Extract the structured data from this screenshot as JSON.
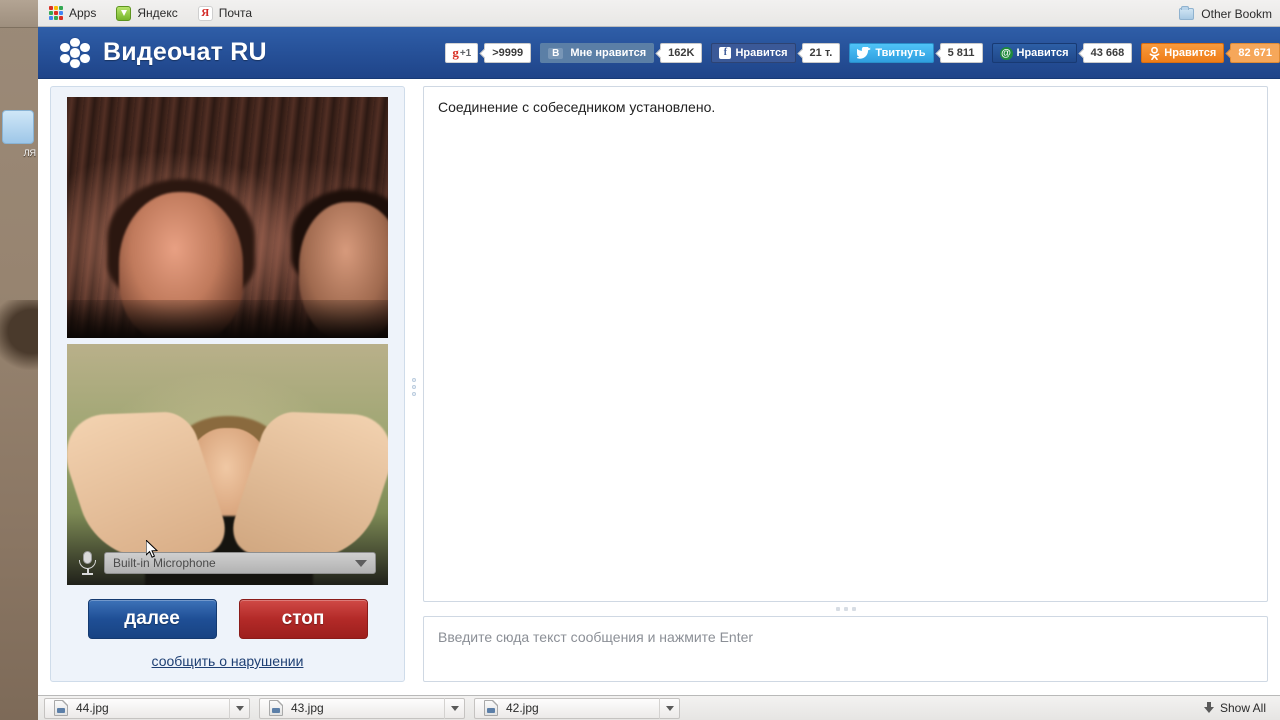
{
  "browser": {
    "bookmarks": [
      {
        "label": "Apps",
        "icon": "apps-grid-icon"
      },
      {
        "label": "Яндекс",
        "icon": "yandex-icon"
      },
      {
        "label": "Почта",
        "icon": "mail-icon"
      }
    ],
    "other_bookmarks": {
      "label": "Other Bookm",
      "icon": "folder-icon"
    }
  },
  "site": {
    "brand": "Видеочат RU",
    "brand_icon": "flower-logo-icon",
    "header_color": "#27529a",
    "social": [
      {
        "name": "google-plus",
        "label": "+1",
        "glyph": "g",
        "count": ">9999"
      },
      {
        "name": "vkontakte",
        "label": "Мне нравится",
        "glyph": "В",
        "count": "162K"
      },
      {
        "name": "facebook",
        "label": "Нравится",
        "glyph": "f",
        "count": "21 т."
      },
      {
        "name": "twitter",
        "label": "Твитнуть",
        "glyph": "bird",
        "count": "5 811"
      },
      {
        "name": "mailru",
        "label": "Нравится",
        "glyph": "@",
        "count": "43 668"
      },
      {
        "name": "odnoklassniki",
        "label": "Нравится",
        "glyph": "ok",
        "count": "82 671"
      }
    ]
  },
  "left_panel": {
    "remote_video_name": "remote-video",
    "local_video_name": "local-video",
    "mic": {
      "icon": "microphone-icon",
      "selected": "Built-in Microphone",
      "options": [
        "Built-in Microphone"
      ]
    },
    "buttons": {
      "next": "далее",
      "stop": "стоп"
    },
    "report_link": "сообщить о нарушении"
  },
  "chat": {
    "messages": [
      "Соединение с собеседником установлено."
    ],
    "input_placeholder": "Введите сюда текст сообщения и нажмите Enter",
    "input_value": ""
  },
  "downloads": {
    "items": [
      {
        "name": "44.jpg"
      },
      {
        "name": "43.jpg"
      },
      {
        "name": "42.jpg"
      }
    ],
    "show_all": "Show All"
  },
  "desktop": {
    "icon_label": "ЛЯ"
  }
}
